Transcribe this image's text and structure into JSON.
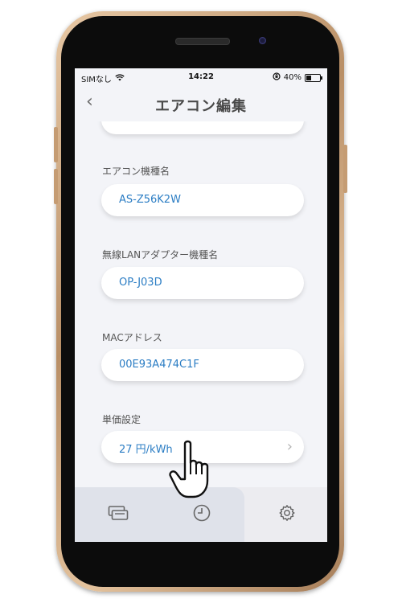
{
  "status_bar": {
    "carrier": "SIMなし",
    "time": "14:22",
    "battery_percent": "40%",
    "battery_level": 0.4
  },
  "nav": {
    "back_icon": "chevron-left-icon",
    "title": "エアコン編集"
  },
  "fields": [
    {
      "label": "エアコン機種名",
      "value": "AS-Z56K2W"
    },
    {
      "label": "無線LANアダプター機種名",
      "value": "OP-J03D"
    },
    {
      "label": "MACアドレス",
      "value": "00E93A474C1F"
    },
    {
      "label": "単価設定",
      "value": "27 円/kWh"
    }
  ],
  "tabs": [
    {
      "icon": "devices-icon"
    },
    {
      "icon": "clock-icon"
    },
    {
      "icon": "gear-icon"
    }
  ],
  "colors": {
    "accent_text": "#2b7dc4",
    "screen_bg": "#f3f4f8",
    "frame_gold": "#c59c73"
  }
}
